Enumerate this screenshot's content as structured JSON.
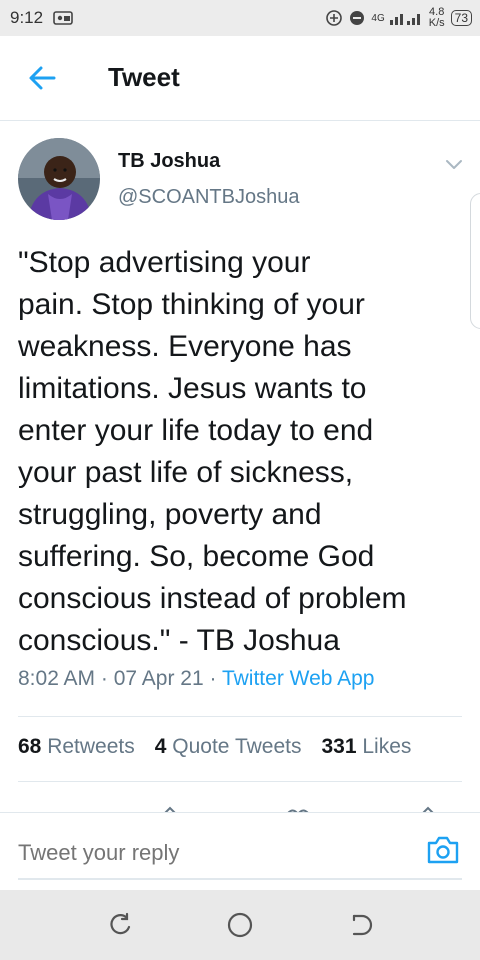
{
  "status_bar": {
    "time": "9:12",
    "network": "4G",
    "speed_value": "4.8",
    "speed_unit": "K/s",
    "battery": "73"
  },
  "header": {
    "title": "Tweet"
  },
  "tweet": {
    "author_name": "TB Joshua",
    "author_handle": "@SCOANTBJoshua",
    "text": "\"Stop advertising your\npain. Stop thinking of your\nweakness. Everyone has\nlimitations. Jesus wants to\nenter your life today to end\nyour past life of sickness,\nstruggling, poverty and\nsuffering. So, become God\nconscious instead of problem\nconscious.\" - TB Joshua",
    "time": "8:02 AM",
    "date": "07 Apr 21",
    "separator": "·",
    "source": "Twitter Web App",
    "stats": {
      "retweets_count": "68",
      "retweets_label": "Retweets",
      "quotes_count": "4",
      "quotes_label": "Quote Tweets",
      "likes_count": "331",
      "likes_label": "Likes"
    }
  },
  "reply": {
    "placeholder": "Tweet your reply"
  },
  "colors": {
    "accent": "#1da1f2",
    "secondary_text": "#657786",
    "primary_text": "#14171a",
    "divider": "#e1e8ed"
  },
  "icons": {
    "back": "arrow-left-icon",
    "caret": "chevron-down-icon",
    "camera": "camera-icon",
    "nav_recent": "recents-icon",
    "nav_home": "home-circle-icon",
    "nav_back": "nav-back-icon"
  }
}
